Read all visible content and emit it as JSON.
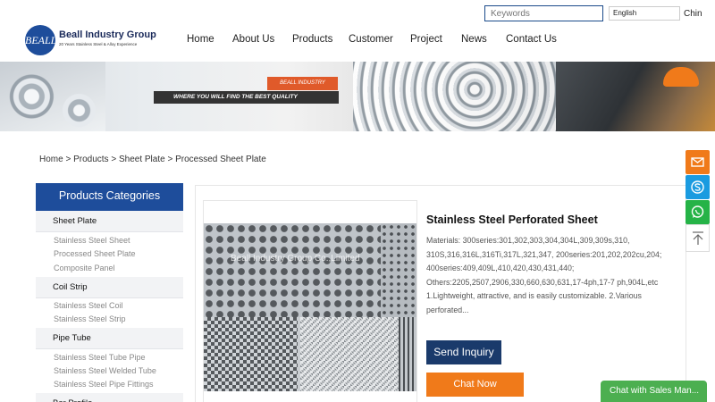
{
  "header": {
    "search_placeholder": "Keywords",
    "language": "English",
    "language_extra": "Chin",
    "logo_mark": "BEALL",
    "logo_name": "Beall Industry Group",
    "logo_tagline": "20 Years Stainless Steel & Alloy Experience"
  },
  "nav": [
    "Home",
    "About Us",
    "Products",
    "Customer",
    "Project",
    "News",
    "Contact Us"
  ],
  "banner": {
    "brand": "BEALL INDUSTRY",
    "slogan": "WHERE YOU WILL FIND THE BEST QUALITY"
  },
  "breadcrumb": [
    "Home",
    "Products",
    "Sheet Plate",
    "Processed Sheet Plate"
  ],
  "sidebar": {
    "title": "Products Categories",
    "categories": [
      {
        "label": "Sheet Plate",
        "items": [
          "Stainless Steel Sheet",
          "Processed Sheet Plate",
          "Composite Panel"
        ]
      },
      {
        "label": "Coil Strip",
        "items": [
          "Stainless Steel Coil",
          "Stainless Steel Strip"
        ]
      },
      {
        "label": "Pipe Tube",
        "items": [
          "Stainless Steel Tube Pipe",
          "Stainless Steel Welded Tube",
          "Stainless Steel Pipe Fittings"
        ]
      },
      {
        "label": "Bar Profile",
        "items": []
      }
    ]
  },
  "product": {
    "watermark": "Beall Industry Group Co.,Limited",
    "title": "Stainless Steel Perforated Sheet",
    "description": "Materials: 300series:301,302,303,304,304L,309,309s,310, 310S,316,316L,316Ti,317L,321,347, 200series:201,202,202cu,204; 400series:409,409L,410,420,430,431,440; Others:2205,2507,2906,330,660,630,631,17-4ph,17-7 ph,904L,etc 1.Lightweight, attractive, and is easily customizable. 2.Various perforated...",
    "inquiry_label": "Send Inquiry",
    "chat_label": "Chat Now"
  },
  "floating": {
    "icons": [
      "email-icon",
      "skype-icon",
      "whatsapp-icon",
      "arrow-up-icon"
    ],
    "colors": {
      "email": "#f07a1a",
      "skype": "#1a9be0",
      "whatsapp": "#25b347"
    }
  },
  "sales_chat": "Chat with Sales Man...",
  "colors": {
    "primary": "#1e4d9b",
    "accent": "#f07a1a",
    "dark_button": "#1a3a6b",
    "chat_green": "#4caf50"
  }
}
